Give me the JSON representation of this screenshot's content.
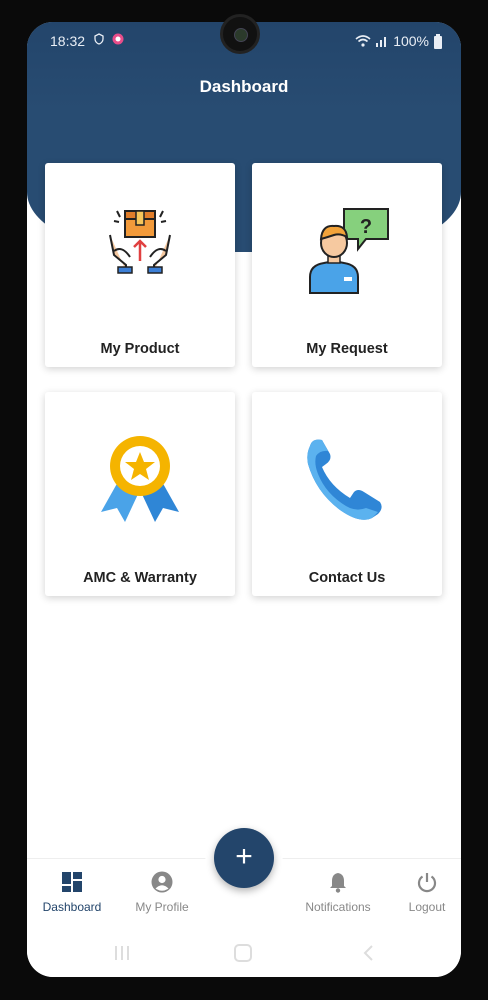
{
  "statusbar": {
    "time": "18:32",
    "battery": "100%"
  },
  "header": {
    "title": "Dashboard"
  },
  "cards": [
    {
      "label": "My Product",
      "icon": "product-box-hands-icon"
    },
    {
      "label": "My Request",
      "icon": "support-agent-question-icon"
    },
    {
      "label": "AMC & Warranty",
      "icon": "award-ribbon-icon"
    },
    {
      "label": "Contact Us",
      "icon": "phone-icon"
    }
  ],
  "fab": {
    "label": "+"
  },
  "nav": {
    "items": [
      {
        "label": "Dashboard",
        "icon": "dashboard-icon",
        "active": true
      },
      {
        "label": "My Profile",
        "icon": "profile-icon"
      },
      {
        "label": "Notifications",
        "icon": "bell-icon"
      },
      {
        "label": "Logout",
        "icon": "power-icon"
      }
    ]
  },
  "colors": {
    "primary": "#23456b",
    "nav_inactive": "#888888",
    "card_bg": "#ffffff"
  }
}
